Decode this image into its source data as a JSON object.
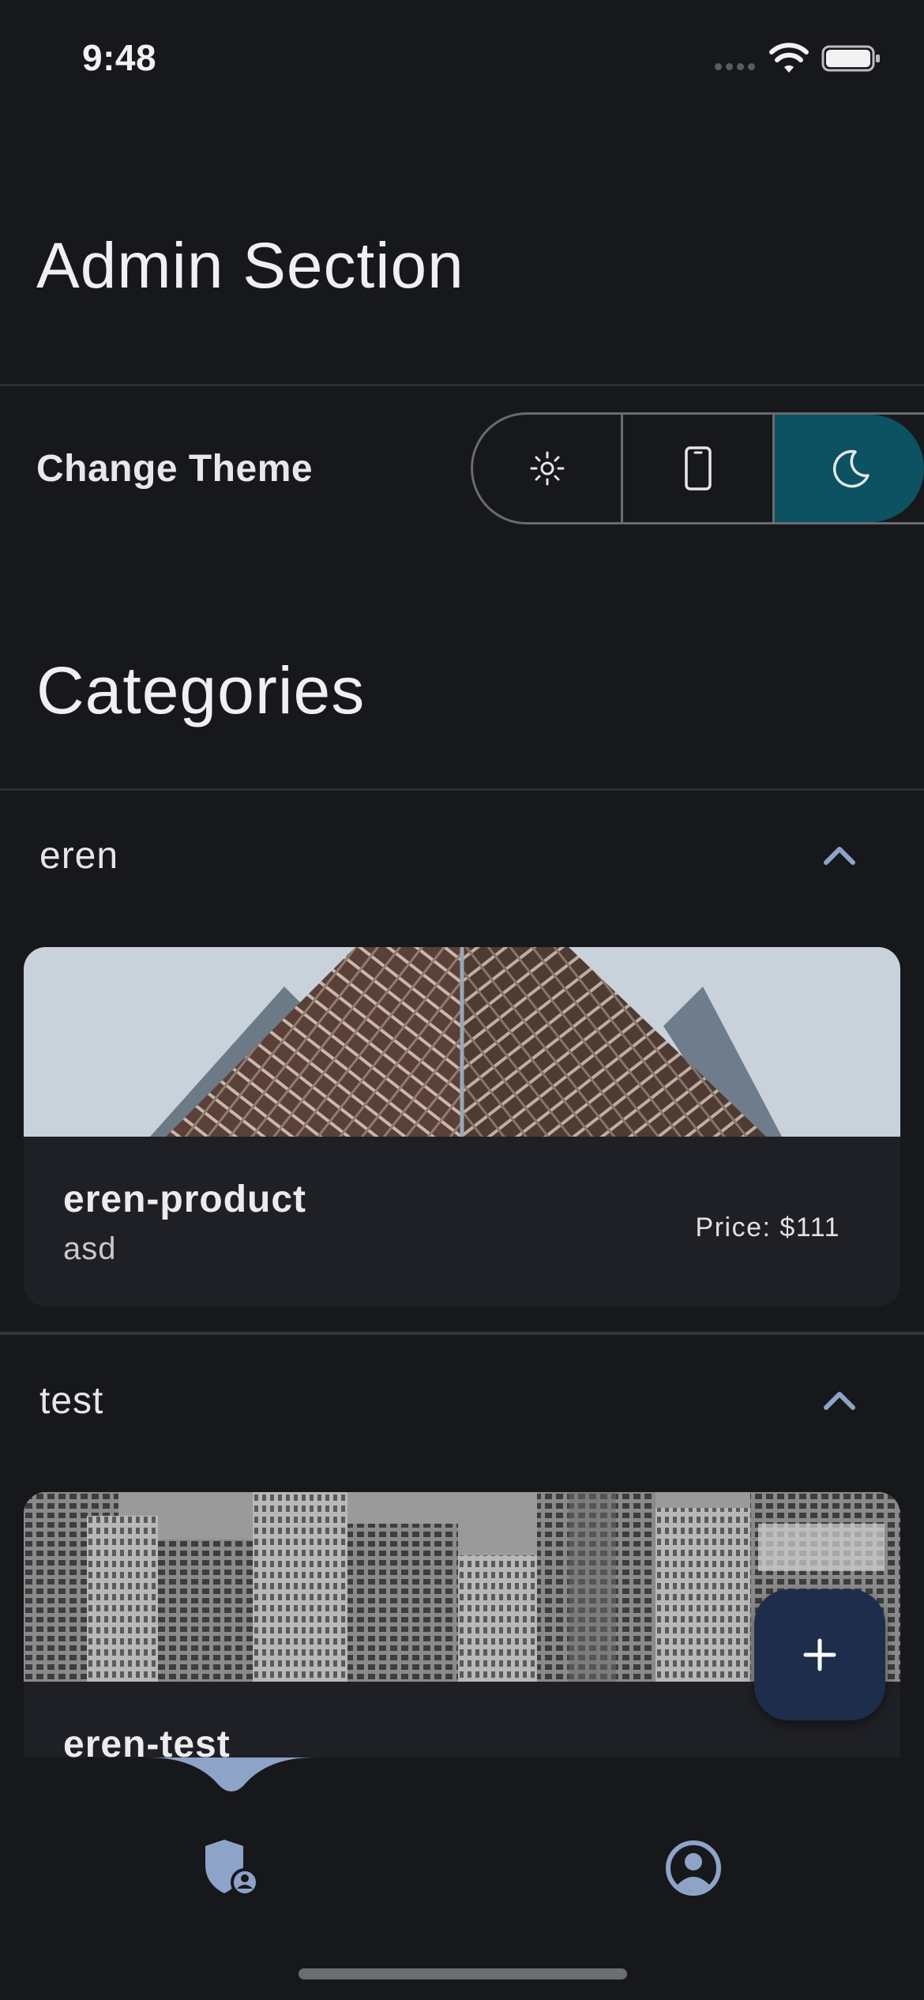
{
  "status_bar": {
    "time": "9:48"
  },
  "page_title": "Admin Section",
  "theme": {
    "label": "Change Theme",
    "options": [
      "light",
      "system",
      "dark"
    ],
    "selected": "dark",
    "selected_color": "#0c5263"
  },
  "categories_title": "Categories",
  "categories": [
    {
      "name": "eren",
      "expanded": true,
      "product": {
        "name": "eren-product",
        "description": "asd",
        "price": "Price: $111"
      }
    },
    {
      "name": "test",
      "expanded": true,
      "product": {
        "name": "eren-test"
      }
    }
  ],
  "fab_icon": "plus-icon",
  "bottom_nav": {
    "items": [
      "admin-shield-icon",
      "profile-icon"
    ],
    "active": "admin-shield-icon",
    "accent": "#8ea3c8"
  }
}
